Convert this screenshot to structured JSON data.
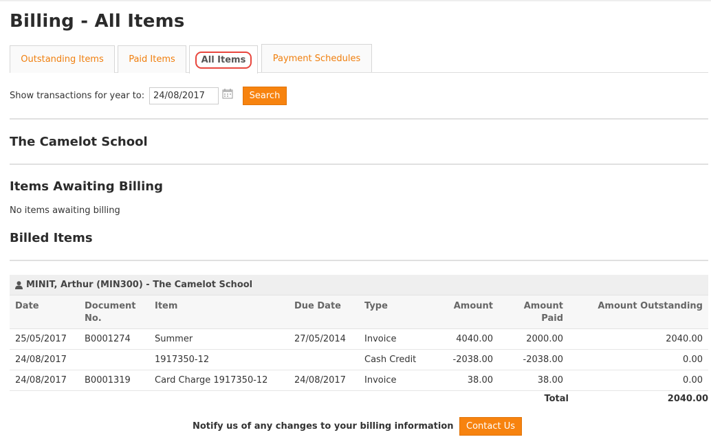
{
  "page": {
    "title": "Billing - All Items"
  },
  "tabs": [
    {
      "label": "Outstanding Items"
    },
    {
      "label": "Paid Items"
    },
    {
      "label": "All Items"
    },
    {
      "label": "Payment Schedules"
    }
  ],
  "filter": {
    "label": "Show transactions for year to:",
    "date_value": "24/08/2017",
    "search_label": "Search"
  },
  "school": {
    "name": "The Camelot School"
  },
  "awaiting": {
    "heading": "Items Awaiting Billing",
    "empty_text": "No items awaiting billing"
  },
  "billed": {
    "heading": "Billed Items",
    "group_label": "MINIT, Arthur (MIN300) - The Camelot School",
    "columns": {
      "date": "Date",
      "document_no": "Document No.",
      "item": "Item",
      "due_date": "Due Date",
      "type": "Type",
      "amount": "Amount",
      "amount_paid": "Amount Paid",
      "amount_outstanding": "Amount Outstanding"
    },
    "rows": [
      {
        "date": "25/05/2017",
        "document_no": "B0001274",
        "item": "Summer",
        "due_date": "27/05/2014",
        "type": "Invoice",
        "amount": "4040.00",
        "amount_paid": "2000.00",
        "amount_outstanding": "2040.00"
      },
      {
        "date": "24/08/2017",
        "document_no": "",
        "item": "1917350-12",
        "due_date": "",
        "type": "Cash Credit",
        "amount": "-2038.00",
        "amount_paid": "-2038.00",
        "amount_outstanding": "0.00"
      },
      {
        "date": "24/08/2017",
        "document_no": "B0001319",
        "item": "Card Charge 1917350-12",
        "due_date": "24/08/2017",
        "type": "Invoice",
        "amount": "38.00",
        "amount_paid": "38.00",
        "amount_outstanding": "0.00"
      }
    ],
    "total_label": "Total",
    "total_value": "2040.00"
  },
  "footer": {
    "notify_text": "Notify us of any changes to your billing information",
    "contact_label": "Contact Us"
  },
  "icons": {
    "calendar": "calendar-icon",
    "person": "person-icon"
  },
  "colors": {
    "accent": "#f7830f",
    "active_tab_outline": "#e8453c"
  }
}
